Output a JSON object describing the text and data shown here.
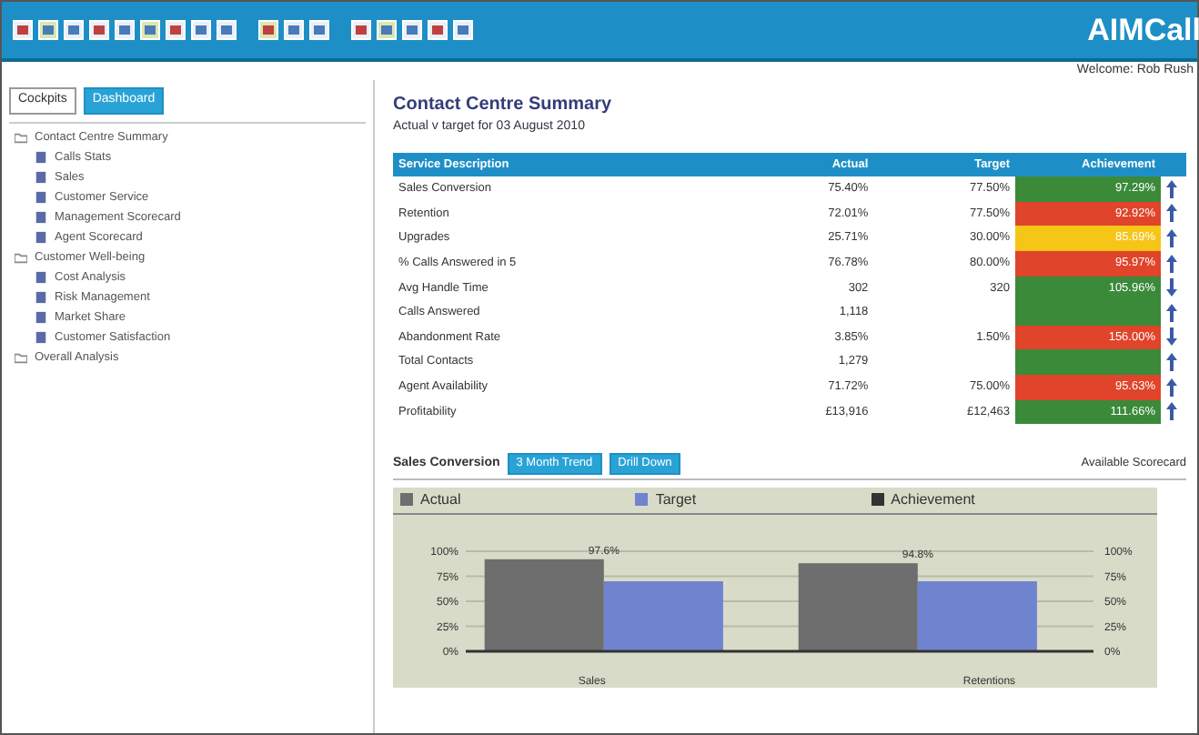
{
  "header": {
    "app_title": "AIMCall",
    "user": "Welcome: Rob Rush"
  },
  "sidebar": {
    "tabs": [
      {
        "label": "Cockpits",
        "selected": false
      },
      {
        "label": "Dashboard",
        "selected": true
      }
    ],
    "tree": [
      {
        "label": "Contact Centre Summary",
        "children": [
          {
            "label": "Calls Stats"
          },
          {
            "label": "Sales"
          },
          {
            "label": "Customer Service"
          },
          {
            "label": "Management Scorecard"
          },
          {
            "label": "Agent Scorecard"
          }
        ]
      },
      {
        "label": "Customer Well-being",
        "children": [
          {
            "label": "Cost Analysis"
          },
          {
            "label": "Risk Management"
          },
          {
            "label": "Market Share"
          },
          {
            "label": "Customer Satisfaction"
          }
        ]
      },
      {
        "label": "Overall Analysis"
      }
    ]
  },
  "summary": {
    "title": "Contact Centre Summary",
    "subtitle": "Actual v target for 03 August 2010",
    "columns": [
      "Service Description",
      "Actual",
      "Target",
      "Achievement"
    ],
    "rows": [
      {
        "name": "Sales Conversion",
        "actual": "75.40%",
        "target": "77.50%",
        "achievement": "97.29%",
        "color": "#3a8a3a",
        "trend_up": true
      },
      {
        "name": "Retention",
        "actual": "72.01%",
        "target": "77.50%",
        "achievement": "92.92%",
        "color": "#e0442a",
        "trend_up": true
      },
      {
        "name": "Upgrades",
        "actual": "25.71%",
        "target": "30.00%",
        "achievement": "85.69%",
        "color": "#f5c518",
        "trend_up": true
      },
      {
        "name": "% Calls Answered in 5",
        "actual": "76.78%",
        "target": "80.00%",
        "achievement": "95.97%",
        "color": "#e0442a",
        "trend_up": true
      },
      {
        "name": "Avg Handle Time",
        "actual": "302",
        "target": "320",
        "achievement": "105.96%",
        "color": "#3a8a3a",
        "trend_up": false
      },
      {
        "name": "Calls Answered",
        "actual": "1,118",
        "color": "#3a8a3a",
        "trend_up": true
      },
      {
        "name": "Abandonment Rate",
        "actual": "3.85%",
        "target": "1.50%",
        "achievement": "156.00%",
        "color": "#e0442a",
        "trend_up": false
      },
      {
        "name": "Total Contacts",
        "actual": "1,279",
        "color": "#3a8a3a",
        "trend_up": true
      },
      {
        "name": "Agent Availability",
        "actual": "71.72%",
        "target": "75.00%",
        "achievement": "95.63%",
        "color": "#e0442a",
        "trend_up": true
      },
      {
        "name": "Profitability",
        "actual": "£13,916",
        "target": "£12,463",
        "achievement": "111.66%",
        "color": "#3a8a3a",
        "trend_up": true
      }
    ]
  },
  "detail": {
    "title": "Sales Conversion",
    "buttons": [
      "3 Month Trend",
      "Drill Down"
    ],
    "note": "Available Scorecard",
    "line_legend": {
      "label": "Achievement",
      "color": "#333333"
    },
    "chart_data": {
      "type": "bar",
      "categories": [
        "Sales",
        "Retentions"
      ],
      "series": [
        {
          "name": "Actual",
          "color": "#6e6e6e",
          "values": [
            92,
            88
          ]
        },
        {
          "name": "Target",
          "color": "#6f83cf",
          "values": [
            70,
            70
          ]
        }
      ],
      "ylim": [
        0,
        100
      ],
      "grid": true,
      "yticks": [
        {
          "value": 0,
          "label": "0%"
        },
        {
          "value": 25,
          "label": "25%"
        },
        {
          "value": 50,
          "label": "50%"
        },
        {
          "value": 75,
          "label": "75%"
        },
        {
          "value": 100,
          "label": "100%"
        }
      ],
      "annotations": [
        "97.6%",
        "94.8%"
      ]
    }
  }
}
